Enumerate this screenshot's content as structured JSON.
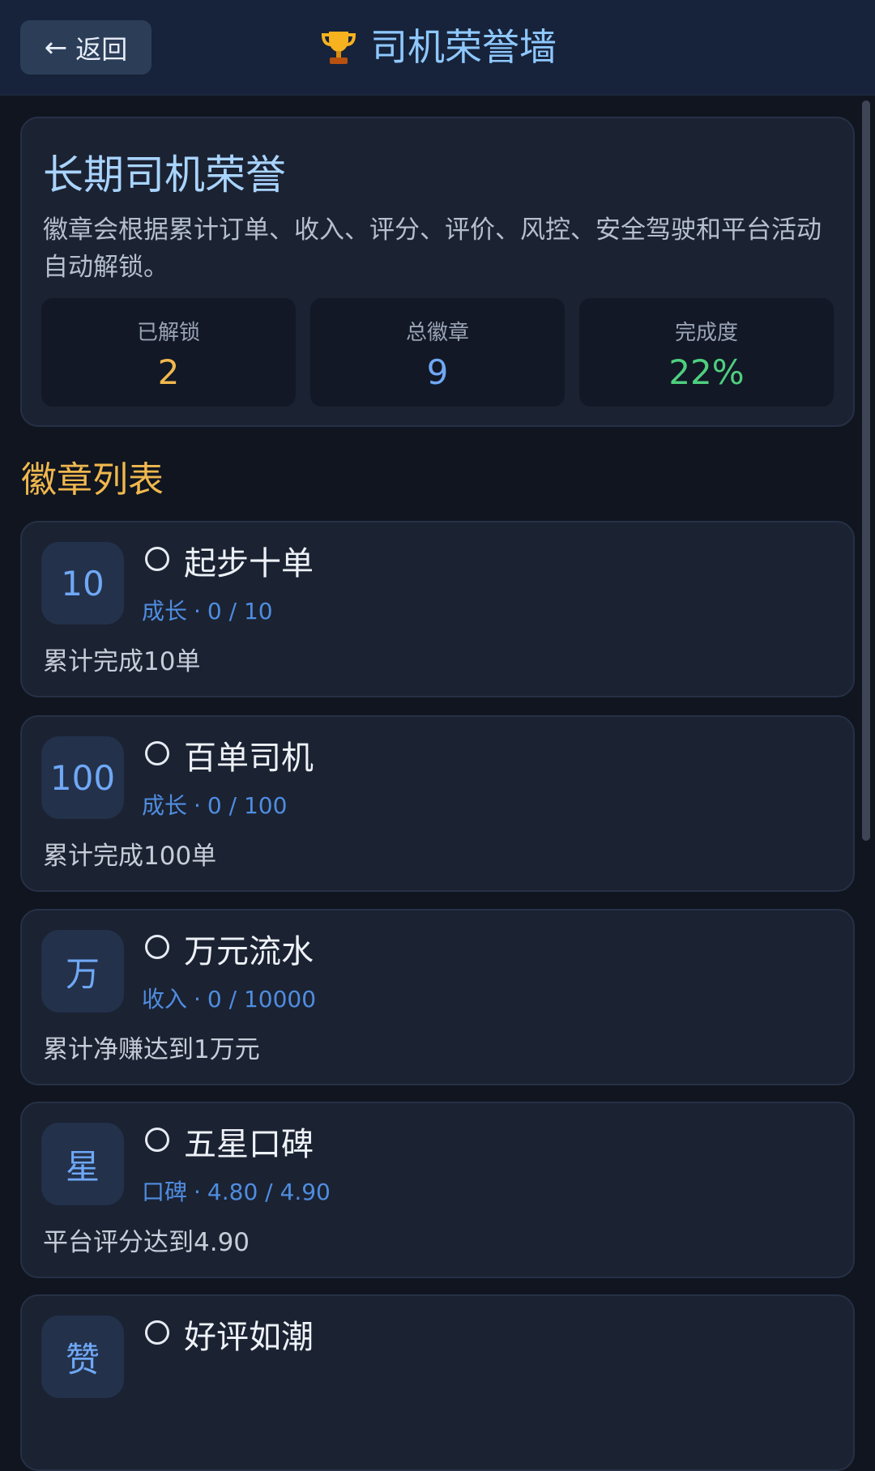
{
  "header": {
    "back_label": "返回",
    "back_arrow": "←",
    "title": "司机荣誉墙",
    "title_icon": "trophy-icon"
  },
  "summary": {
    "title": "长期司机荣誉",
    "description": "徽章会根据累计订单、收入、评分、评价、风控、安全驾驶和平台活动自动解锁。",
    "stats": [
      {
        "label": "已解锁",
        "value": "2",
        "color": "#f0b84e"
      },
      {
        "label": "总徽章",
        "value": "9",
        "color": "#6fa8f5"
      },
      {
        "label": "完成度",
        "value": "22%",
        "color": "#4fcf7e"
      }
    ]
  },
  "section": {
    "title": "徽章列表"
  },
  "badges": [
    {
      "icon_text": "10",
      "name": "起步十单",
      "category": "成长",
      "separator": "·",
      "progress": "0 / 10",
      "description": "累计完成10单",
      "unlocked": false
    },
    {
      "icon_text": "100",
      "name": "百单司机",
      "category": "成长",
      "separator": "·",
      "progress": "0 / 100",
      "description": "累计完成100单",
      "unlocked": false
    },
    {
      "icon_text": "万",
      "name": "万元流水",
      "category": "收入",
      "separator": "·",
      "progress": "0 / 10000",
      "description": "累计净赚达到1万元",
      "unlocked": false
    },
    {
      "icon_text": "星",
      "name": "五星口碑",
      "category": "口碑",
      "separator": "·",
      "progress": "4.80 / 4.90",
      "description": "平台评分达到4.90",
      "unlocked": false
    },
    {
      "icon_text": "赞",
      "name": "好评如潮",
      "category": "",
      "separator": "",
      "progress": "",
      "description": "",
      "unlocked": false
    }
  ],
  "colors": {
    "background": "#10151f",
    "header": "#17233a",
    "card": "#1b2232",
    "accent_blue": "#6fa8f5",
    "accent_gold": "#f0b84e",
    "accent_green": "#4fcf7e"
  }
}
